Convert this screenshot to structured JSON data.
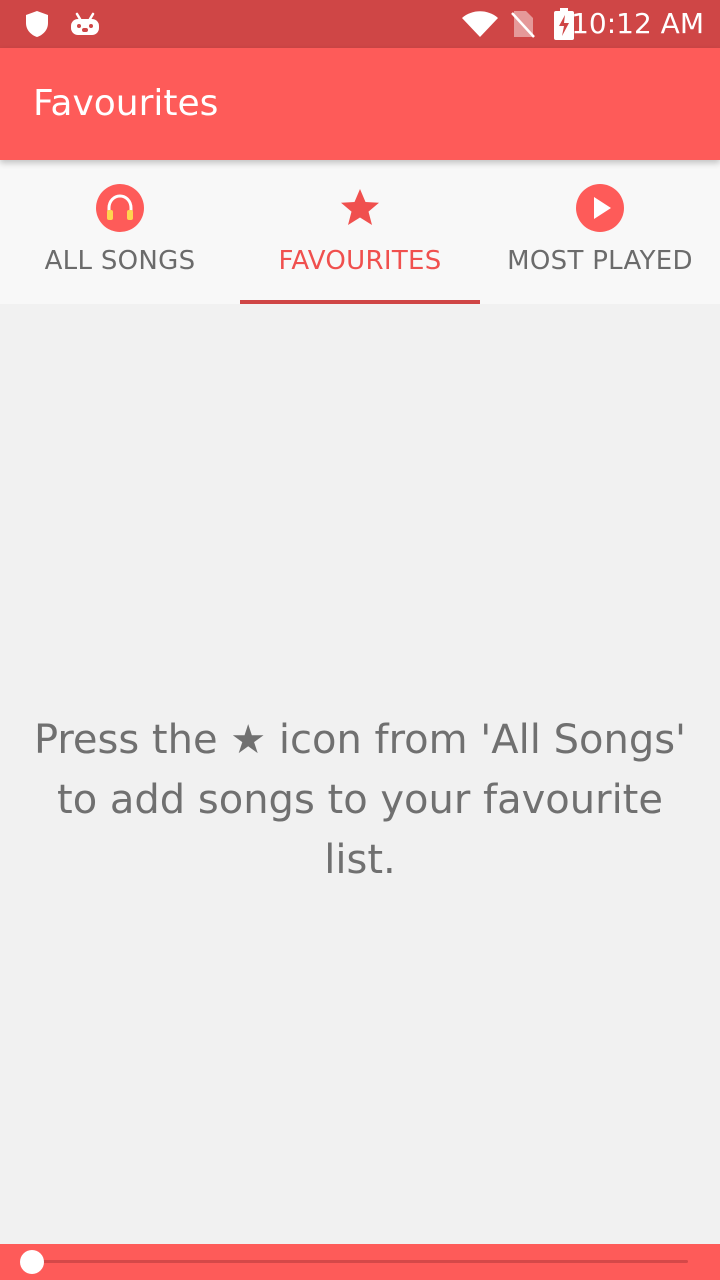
{
  "status_bar": {
    "time": "10:12 AM",
    "icons": [
      "shield-icon",
      "android-debug-icon",
      "wifi-icon",
      "no-sim-icon",
      "battery-charging-icon"
    ]
  },
  "app_bar": {
    "title": "Favourites"
  },
  "tabs": [
    {
      "label": "ALL SONGS",
      "icon": "headphones-icon",
      "active": false
    },
    {
      "label": "FAVOURITES",
      "icon": "star-icon",
      "active": true
    },
    {
      "label": "MOST PLAYED",
      "icon": "play-circle-icon",
      "active": false
    }
  ],
  "content": {
    "empty_message": "Press the ★ icon from 'All Songs' to add songs to your favourite list."
  },
  "player": {
    "progress": 0
  },
  "colors": {
    "status_bar": "#cf4646",
    "primary": "#fe5b59",
    "accent": "#f0504e",
    "tab_text": "#6b6b6b",
    "background": "#f1f1f1"
  }
}
